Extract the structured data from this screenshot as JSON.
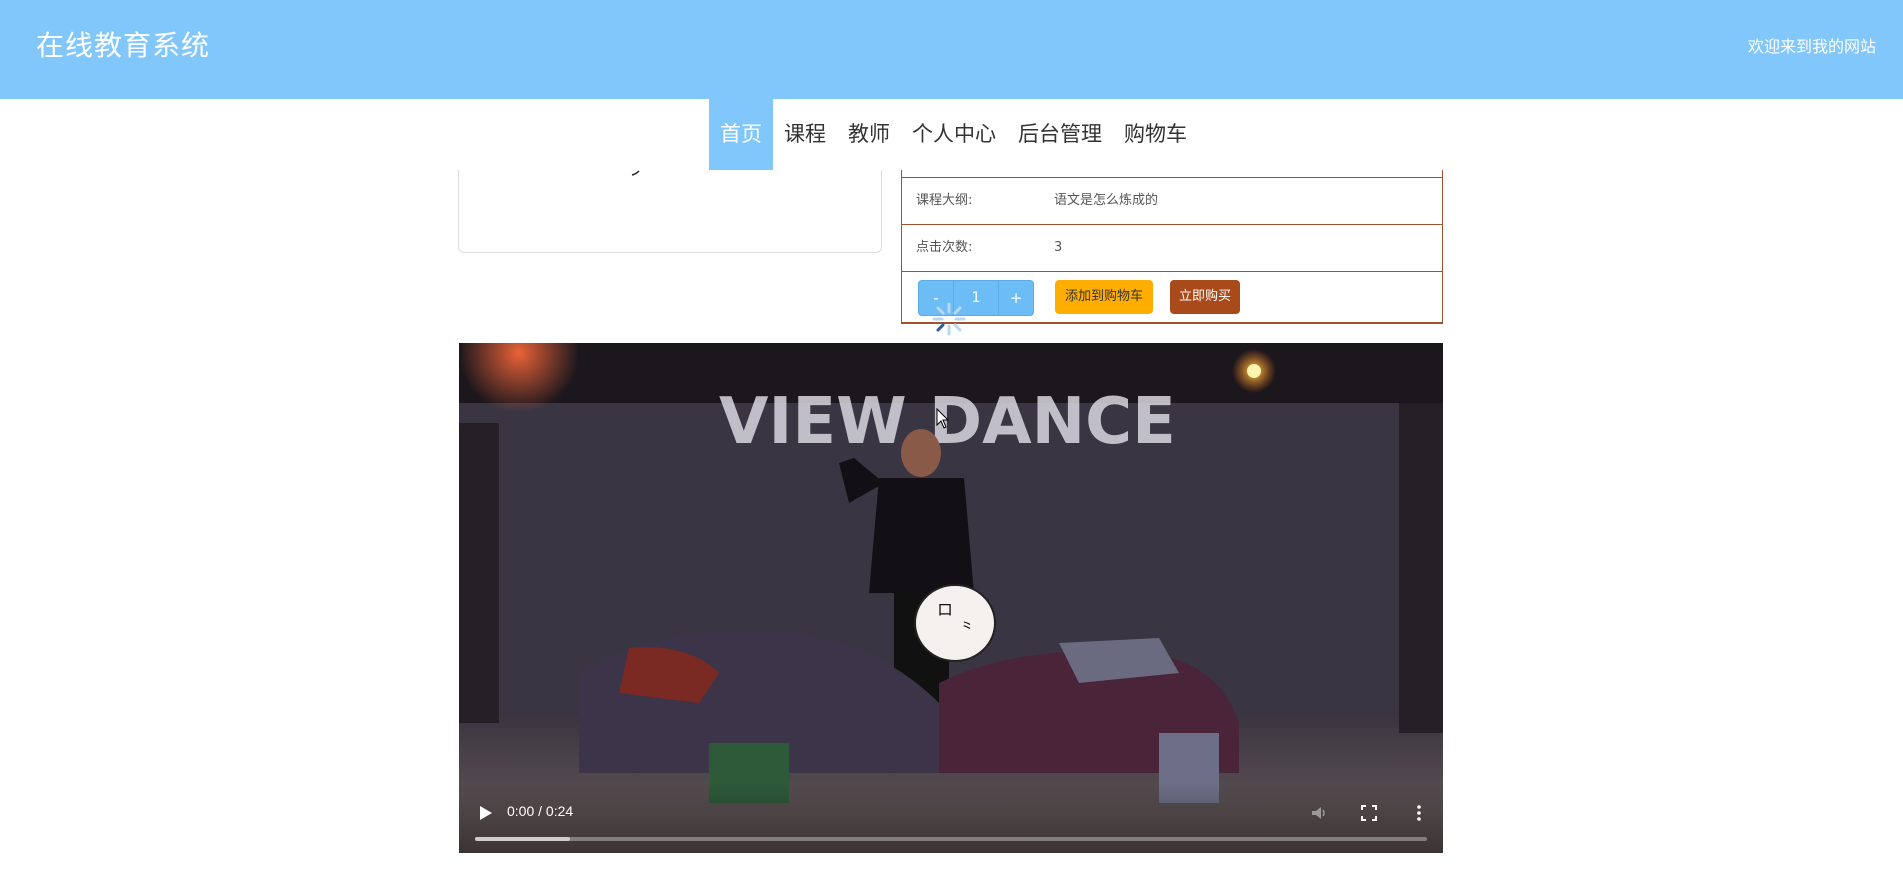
{
  "header": {
    "site_title": "在线教育系统",
    "welcome": "欢迎来到我的网站"
  },
  "nav": {
    "items": [
      {
        "label": "首页",
        "active": true
      },
      {
        "label": "课程",
        "active": false
      },
      {
        "label": "教师",
        "active": false
      },
      {
        "label": "个人中心",
        "active": false
      },
      {
        "label": "后台管理",
        "active": false
      },
      {
        "label": "购物车",
        "active": false
      }
    ]
  },
  "course_info": {
    "outline_label": "课程大纲:",
    "outline_value": "语文是怎么炼成的",
    "clicks_label": "点击次数:",
    "clicks_value": "3",
    "quantity": {
      "minus": "-",
      "value": "1",
      "plus": "+"
    },
    "add_to_cart": "添加到购物车",
    "buy_now": "立即购买"
  },
  "video": {
    "time": "0:00 / 0:24",
    "wall_text": "VIEW DANCE",
    "buffered_fraction": 0.1,
    "icons": [
      "play-icon",
      "volume-icon",
      "fullscreen-icon",
      "more-options-icon"
    ]
  },
  "colors": {
    "header_bg": "#81c7fb",
    "nav_active_bg": "#81c7fb",
    "table_border": "#a0522d",
    "cart_button": "#ffae00",
    "buy_button": "#a84a1a",
    "qty_button": "#6cbcf5"
  }
}
